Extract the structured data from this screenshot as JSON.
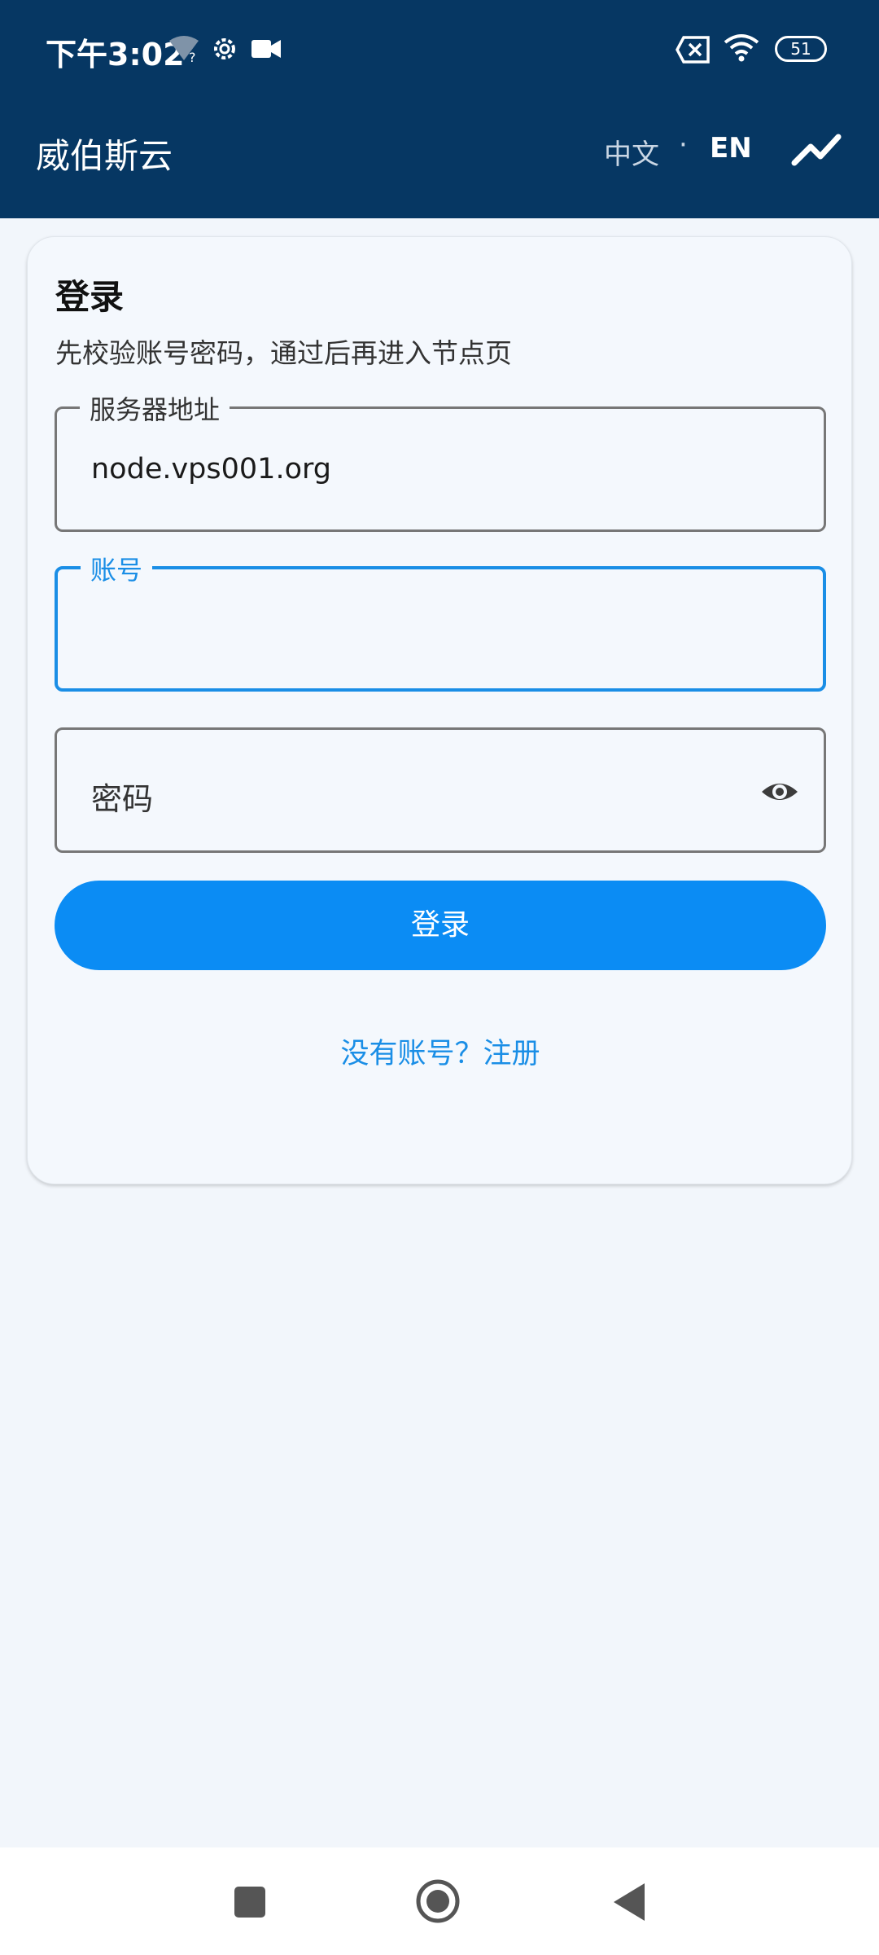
{
  "status_bar": {
    "time": "下午3:02",
    "battery": "51",
    "icons": [
      "wifi-unknown-icon",
      "gear-icon",
      "video-camera-icon",
      "sim-off-icon",
      "wifi-icon",
      "battery-icon"
    ]
  },
  "app_bar": {
    "title": "威伯斯云",
    "lang_zh": "中文",
    "lang_separator": "·",
    "lang_en": "EN",
    "trend_icon": "trending-up-icon"
  },
  "login_card": {
    "title": "登录",
    "subtitle": "先校验账号密码，通过后再进入节点页",
    "server_field": {
      "label": "服务器地址",
      "value": "node.vps001.org"
    },
    "account_field": {
      "label": "账号",
      "value": ""
    },
    "password_field": {
      "placeholder": "密码",
      "icon": "eye-icon"
    },
    "login_button": "登录",
    "register_link": "没有账号？注册"
  },
  "colors": {
    "header_bg": "#063763",
    "accent": "#0b8cf4",
    "focus": "#1a8ee6",
    "background": "#f2f6fb"
  },
  "nav_bar": {
    "icons": [
      "recent-apps-icon",
      "home-icon",
      "back-icon"
    ]
  }
}
